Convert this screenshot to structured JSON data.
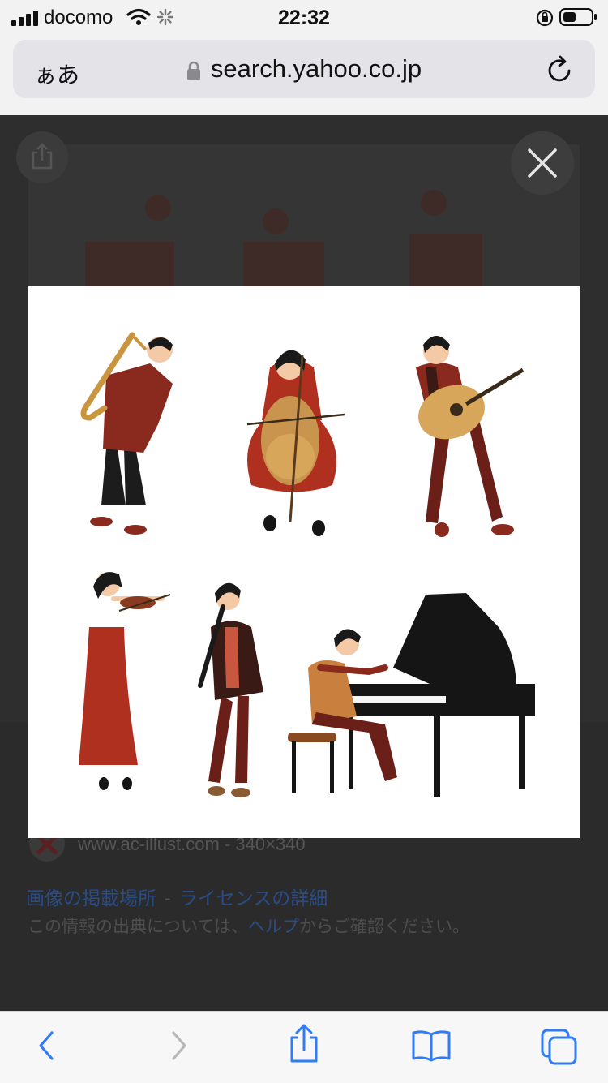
{
  "status_bar": {
    "carrier": "docomo",
    "time": "22:32"
  },
  "browser": {
    "reader_label": "ぁあ",
    "url": "search.yahoo.co.jp"
  },
  "image_info": {
    "source_domain": "www.ac-illust.com",
    "source_separator": "-",
    "dimensions": "340×340",
    "link_source_page": "画像の掲載場所",
    "link_separator": "-",
    "link_license": "ライセンスの詳細",
    "note_prefix": "この情報の出典については、",
    "note_help_link": "ヘルプ",
    "note_suffix": "からご確認ください。"
  },
  "colors": {
    "accent_blue": "#2f7cf6",
    "dress_red": "#b0301f",
    "jacket_maroon": "#8a2a1f",
    "skin": "#f3c9a6",
    "piano_black": "#151515"
  },
  "icons": {
    "signal": "signal-bars-icon",
    "wifi": "wifi-icon",
    "loading": "loading-spinner-icon",
    "orientation_lock": "orientation-lock-icon",
    "battery": "battery-icon",
    "lock": "lock-icon",
    "reload": "reload-icon",
    "close": "close-icon",
    "back": "back-chevron-icon",
    "forward": "forward-chevron-icon",
    "share": "share-icon",
    "bookmarks": "bookmarks-icon",
    "tabs": "tabs-icon"
  }
}
